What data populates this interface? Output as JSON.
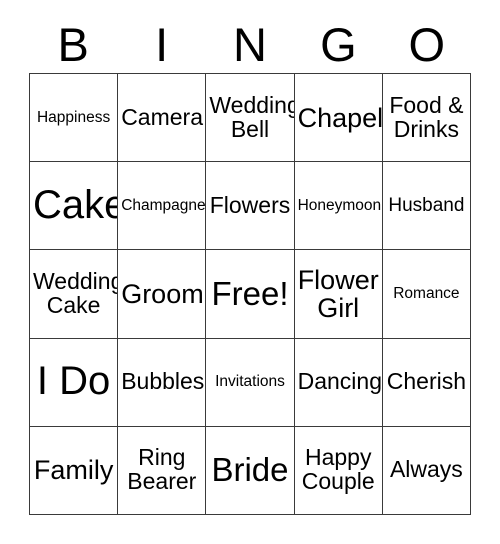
{
  "card": {
    "title_letters": [
      "B",
      "I",
      "N",
      "G",
      "O"
    ],
    "grid": {
      "rows": 5,
      "columns": 5,
      "border_color": "#3a3a3a",
      "background_color": "#ffffff",
      "text_color": "#000000"
    },
    "cells": [
      {
        "text": "Happiness",
        "size": "xs"
      },
      {
        "text": "Camera",
        "size": "md"
      },
      {
        "text": "Wedding\nBell",
        "size": "md"
      },
      {
        "text": "Chapel",
        "size": "lg"
      },
      {
        "text": "Food &\nDrinks",
        "size": "md"
      },
      {
        "text": "Cake",
        "size": "xxl"
      },
      {
        "text": "Champagne",
        "size": "xs"
      },
      {
        "text": "Flowers",
        "size": "md"
      },
      {
        "text": "Honeymoon",
        "size": "xs"
      },
      {
        "text": "Husband",
        "size": "sm"
      },
      {
        "text": "Wedding\nCake",
        "size": "md"
      },
      {
        "text": "Groom",
        "size": "lg"
      },
      {
        "text": "Free!",
        "size": "xl"
      },
      {
        "text": "Flower\nGirl",
        "size": "lg"
      },
      {
        "text": "Romance",
        "size": "xs"
      },
      {
        "text": "I Do",
        "size": "xxl"
      },
      {
        "text": "Bubbles",
        "size": "md"
      },
      {
        "text": "Invitations",
        "size": "xs"
      },
      {
        "text": "Dancing",
        "size": "md"
      },
      {
        "text": "Cherish",
        "size": "md"
      },
      {
        "text": "Family",
        "size": "lg"
      },
      {
        "text": "Ring\nBearer",
        "size": "md"
      },
      {
        "text": "Bride",
        "size": "xl"
      },
      {
        "text": "Happy\nCouple",
        "size": "md"
      },
      {
        "text": "Always",
        "size": "md"
      }
    ]
  }
}
